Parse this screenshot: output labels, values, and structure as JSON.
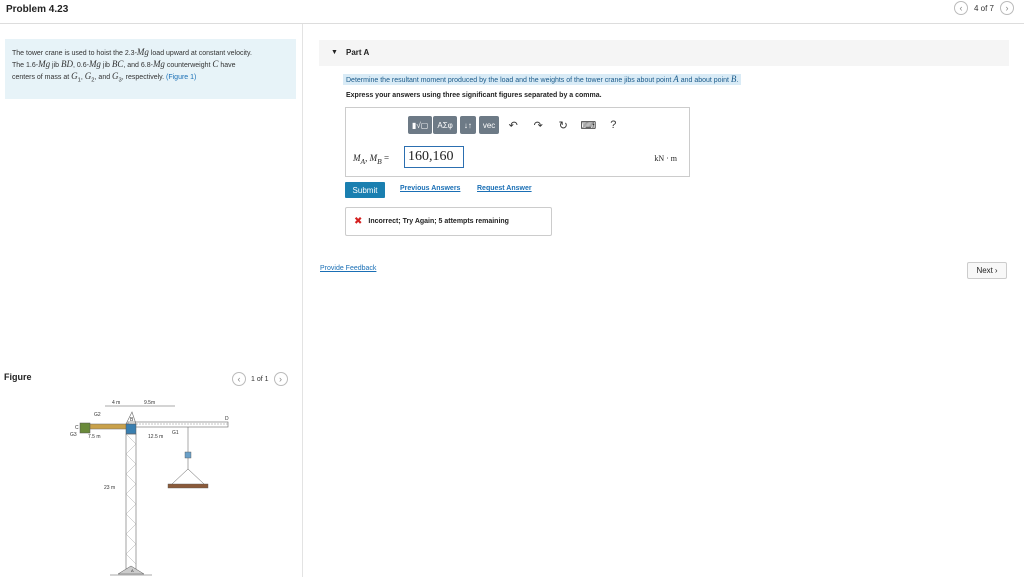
{
  "header": {
    "problem_title": "Problem 4.23",
    "pager_text": "4 of 7",
    "prev_icon": "chevron-left-icon",
    "next_icon": "chevron-right-icon"
  },
  "description": {
    "line1": "The tower crane is used to hoist the 2.3-",
    "mg1": "Mg",
    "line1b": " load upward at constant velocity.",
    "line2a": "The 1.6-",
    "mg2": "Mg",
    "line2b": " jib ",
    "bd": "BD",
    "line2c": ", 0.6-",
    "mg3": "Mg",
    "line2d": " jib ",
    "bc": "BC",
    "line2e": ", and 6.8-",
    "mg4": "Mg",
    "line2f": " counterweight ",
    "c": "C",
    "line2g": " have",
    "line3a": "centers of mass at ",
    "g1": "G",
    "g1sub": "1",
    "line3b": ", ",
    "g2": "G",
    "g2sub": "2",
    "line3c": ", and ",
    "g3": "G",
    "g3sub": "3",
    "line3d": ", respectively. ",
    "figure_link": "(Figure 1)"
  },
  "figure_section": {
    "heading": "Figure",
    "pager_text": "1 of 1",
    "labels": {
      "dim_4m": "4 m",
      "dim_95m": "9.5m",
      "dim_75m": "7.5 m",
      "dim_125m": "12.5 m",
      "dim_23m": "23 m",
      "g2": "G2",
      "g3": "G3",
      "g1": "G1",
      "b": "B",
      "c": "C",
      "d": "D",
      "a": "A"
    }
  },
  "part_a": {
    "label": "Part A",
    "question_a": "Determine the resultant moment produced by the load and the weights of the tower crane jibs about point ",
    "point_a": "A",
    "question_b": " and about point ",
    "point_b": "B",
    "question_c": ".",
    "instruction": "Express your answers using three significant figures separated by a comma.",
    "toolbar": {
      "templates": "▮√▢",
      "greek": "ΑΣφ",
      "arrows": "↓↑",
      "vec": "vec"
    },
    "var_label_m": "M",
    "var_label_a": "A",
    "var_label_sep": ", ",
    "var_label_b": "B",
    "var_label_eq": " = ",
    "answer_value": "160,160",
    "unit": "kN · m",
    "submit_label": "Submit",
    "previous_answers": "Previous Answers",
    "request_answer": "Request Answer",
    "feedback": "Incorrect; Try Again; 5 attempts remaining"
  },
  "footer": {
    "provide_feedback": "Provide Feedback",
    "next_label": "Next"
  }
}
